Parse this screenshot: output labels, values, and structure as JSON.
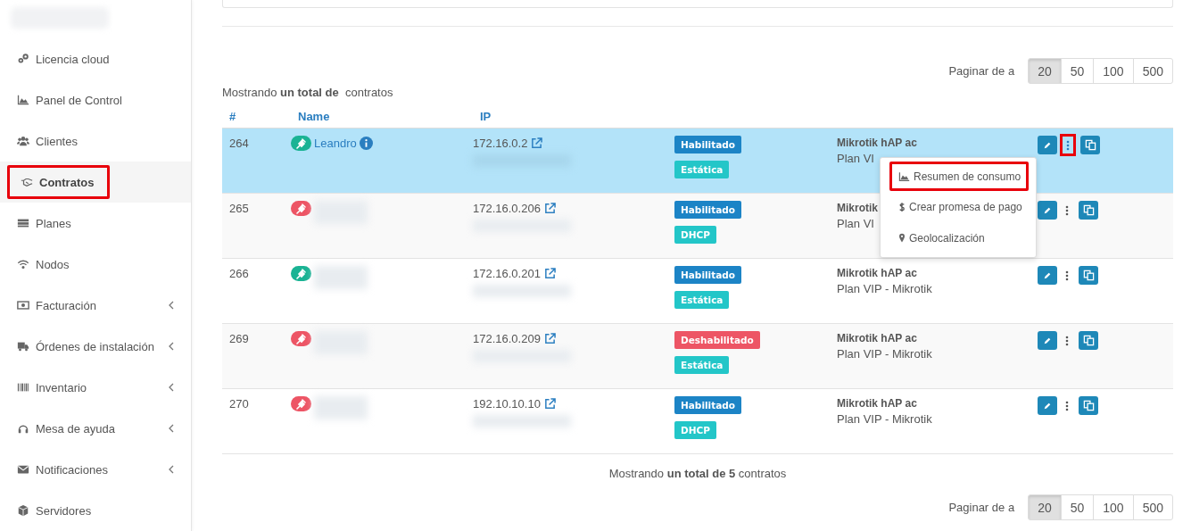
{
  "sidebar": {
    "items": [
      {
        "label": "Licencia cloud",
        "active": false,
        "highlighted": false,
        "submenu": false
      },
      {
        "label": "Panel de Control",
        "active": false,
        "highlighted": false,
        "submenu": false
      },
      {
        "label": "Clientes",
        "active": false,
        "highlighted": false,
        "submenu": false
      },
      {
        "label": "Contratos",
        "active": true,
        "highlighted": true,
        "submenu": false
      },
      {
        "label": "Planes",
        "active": false,
        "highlighted": false,
        "submenu": false
      },
      {
        "label": "Nodos",
        "active": false,
        "highlighted": false,
        "submenu": false
      },
      {
        "label": "Facturación",
        "active": false,
        "highlighted": false,
        "submenu": true
      },
      {
        "label": "Órdenes de instalación",
        "active": false,
        "highlighted": false,
        "submenu": true
      },
      {
        "label": "Inventario",
        "active": false,
        "highlighted": false,
        "submenu": true
      },
      {
        "label": "Mesa de ayuda",
        "active": false,
        "highlighted": false,
        "submenu": true
      },
      {
        "label": "Notificaciones",
        "active": false,
        "highlighted": false,
        "submenu": true
      },
      {
        "label": "Servidores",
        "active": false,
        "highlighted": false,
        "submenu": false
      }
    ]
  },
  "pagination_top": {
    "label": "Paginar de a",
    "options": [
      {
        "label": "20",
        "selected": true
      },
      {
        "label": "50",
        "selected": false
      },
      {
        "label": "100",
        "selected": false
      },
      {
        "label": "500",
        "selected": false
      }
    ]
  },
  "summary_top": "Mostrando **un total de**  contratos",
  "table": {
    "columns": [
      "#",
      "Name",
      "IP"
    ],
    "rows": [
      {
        "id": "264",
        "connected": true,
        "name": "Leandro",
        "ip": "172.16.0.2",
        "status": {
          "label": "Habilitado",
          "kind": "enabled"
        },
        "type": "Estática",
        "model": "Mikrotik hAP ac",
        "plan": "Plan VI",
        "selected": true,
        "menu_open": true
      },
      {
        "id": "265",
        "connected": false,
        "ip": "172.16.0.206",
        "status": {
          "label": "Habilitado",
          "kind": "enabled"
        },
        "type": "DHCP",
        "model": "Mikrotik",
        "plan": "Plan VI",
        "selected": false,
        "menu_open": false
      },
      {
        "id": "266",
        "connected": true,
        "ip": "172.16.0.201",
        "status": {
          "label": "Habilitado",
          "kind": "enabled"
        },
        "type": "Estática",
        "model": "Mikrotik hAP ac",
        "plan": "Plan VIP - Mikrotik",
        "selected": false,
        "menu_open": false
      },
      {
        "id": "269",
        "connected": false,
        "ip": "172.16.0.209",
        "status": {
          "label": "Deshabilitado",
          "kind": "disabled"
        },
        "type": "Estática",
        "model": "Mikrotik hAP ac",
        "plan": "Plan VIP - Mikrotik",
        "selected": false,
        "menu_open": false
      },
      {
        "id": "270",
        "connected": false,
        "ip": "192.10.10.10",
        "status": {
          "label": "Habilitado",
          "kind": "enabled"
        },
        "type": "DHCP",
        "model": "Mikrotik hAP ac",
        "plan": "Plan VIP - Mikrotik",
        "selected": false,
        "menu_open": false
      }
    ]
  },
  "row_menu": {
    "items": [
      {
        "label": "Resumen de consumo",
        "kind": "chart",
        "highlighted": true
      },
      {
        "label": "Crear promesa de pago",
        "kind": "dollar",
        "highlighted": false
      },
      {
        "label": "Geolocalización",
        "kind": "pin",
        "highlighted": false
      }
    ]
  },
  "summary_bottom": "Mostrando **un total de 5** contratos",
  "pagination_bottom": {
    "label": "Paginar de a",
    "options": [
      {
        "label": "20",
        "selected": true
      },
      {
        "label": "50",
        "selected": false
      },
      {
        "label": "100",
        "selected": false
      },
      {
        "label": "500",
        "selected": false
      }
    ]
  }
}
